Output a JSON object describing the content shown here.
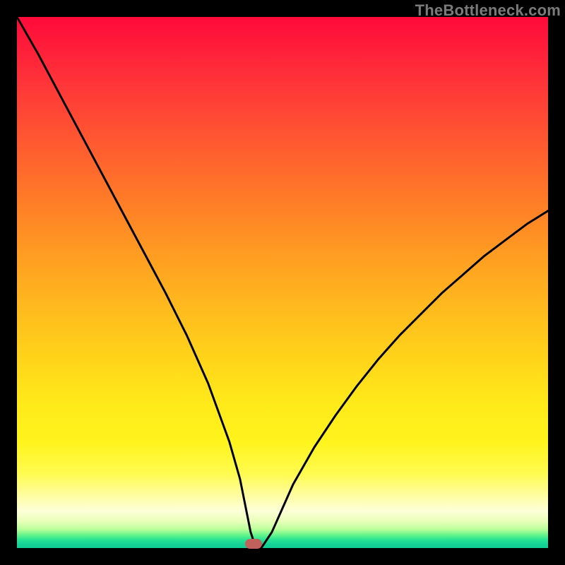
{
  "watermark": "TheBottleneck.com",
  "marker": {
    "x": 44.5,
    "y_pct": 0
  },
  "chart_data": {
    "type": "line",
    "title": "",
    "xlabel": "",
    "ylabel": "",
    "xlim": [
      0,
      100
    ],
    "ylim": [
      0,
      100
    ],
    "grid": false,
    "legend": false,
    "annotations": [],
    "series": [
      {
        "name": "bottleneck-curve",
        "x": [
          0,
          4,
          8,
          12,
          16,
          20,
          24,
          28,
          32,
          36,
          40,
          42,
          44,
          45,
          46,
          48,
          52,
          56,
          60,
          64,
          68,
          72,
          76,
          80,
          84,
          88,
          92,
          96,
          100
        ],
        "y": [
          100,
          93,
          85.5,
          78,
          70.5,
          63,
          55.5,
          48,
          40,
          31,
          20,
          13,
          3,
          0,
          0,
          3,
          12,
          19,
          25,
          30.5,
          35.5,
          40,
          44,
          48,
          51.5,
          55,
          58,
          61,
          63.5
        ]
      }
    ],
    "background_gradient": {
      "direction": "vertical",
      "stops": [
        {
          "pos": 0.0,
          "color": "#ff0a3a"
        },
        {
          "pos": 0.5,
          "color": "#ffc01c"
        },
        {
          "pos": 0.8,
          "color": "#fff41c"
        },
        {
          "pos": 0.93,
          "color": "#fdffd8"
        },
        {
          "pos": 1.0,
          "color": "#10cc91"
        }
      ]
    },
    "marker": {
      "x": 44.5,
      "y": 0,
      "shape": "pill",
      "color": "#c0615c"
    }
  }
}
